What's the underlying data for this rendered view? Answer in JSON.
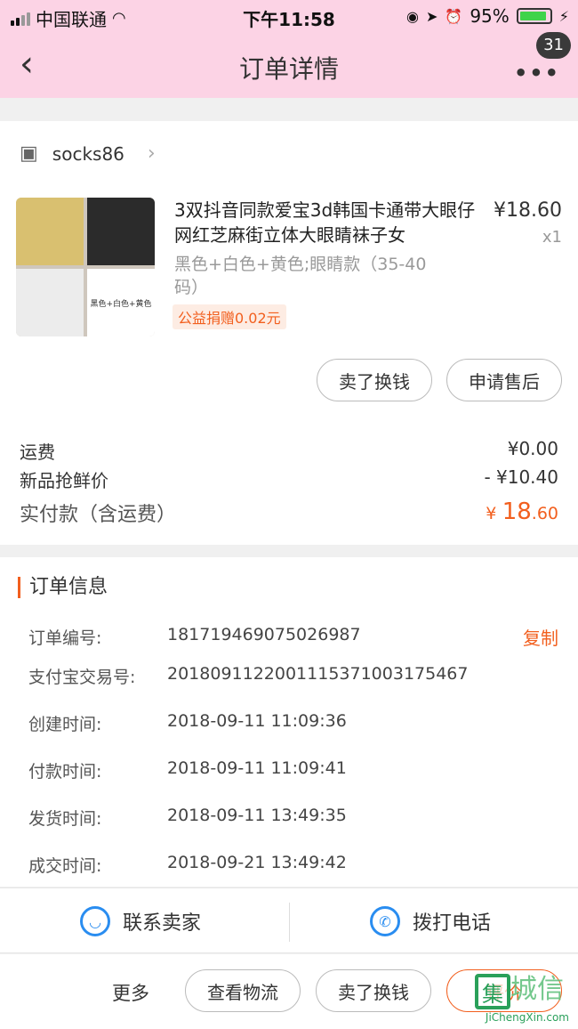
{
  "status_bar": {
    "carrier": "中国联通",
    "time": "下午11:58",
    "battery": "95%"
  },
  "nav": {
    "title": "订单详情",
    "badge": "31"
  },
  "shop": {
    "name": "socks86"
  },
  "product": {
    "title": "3双抖音同款爱宝3d韩国卡通带大眼仔网红芝麻街立体大眼睛袜子女",
    "price": "¥18.60",
    "qty": "x1",
    "spec": "黑色+白色+黄色;眼睛款（35-40码）",
    "thumb_caption": "黑色+白色+黄色",
    "donation_tag": "公益捐赠0.02元"
  },
  "actions": {
    "sell_swap": "卖了换钱",
    "after_sale": "申请售后"
  },
  "fees": {
    "shipping_label": "运费",
    "shipping_value": "¥0.00",
    "discount_label": "新品抢鲜价",
    "discount_value": "- ¥10.40",
    "paid_label": "实付款（含运费）",
    "paid_currency": "¥",
    "paid_int": "18",
    "paid_dec": ".60"
  },
  "order_info": {
    "title": "订单信息",
    "copy": "复制",
    "rows": [
      {
        "label": "订单编号:",
        "value": "181719469075026987"
      },
      {
        "label": "支付宝交易号:",
        "value": "2018091122001115371003175467"
      },
      {
        "label": "创建时间:",
        "value": "2018-09-11 11:09:36"
      },
      {
        "label": "付款时间:",
        "value": "2018-09-11 11:09:41"
      },
      {
        "label": "发货时间:",
        "value": "2018-09-11 13:49:35"
      },
      {
        "label": "成交时间:",
        "value": "2018-09-21 13:49:42"
      }
    ]
  },
  "contact": {
    "seller": "联系卖家",
    "phone": "拨打电话"
  },
  "bottom": {
    "more": "更多",
    "logistics": "查看物流",
    "sell_swap": "卖了换钱",
    "review": "评价"
  },
  "watermark": {
    "site": "JiChengXin.com",
    "char": "集",
    "name": "城信"
  },
  "colors": {
    "header_bg": "#fcd3e5",
    "accent": "#f25f1e",
    "icon_blue": "#2a8df0"
  }
}
